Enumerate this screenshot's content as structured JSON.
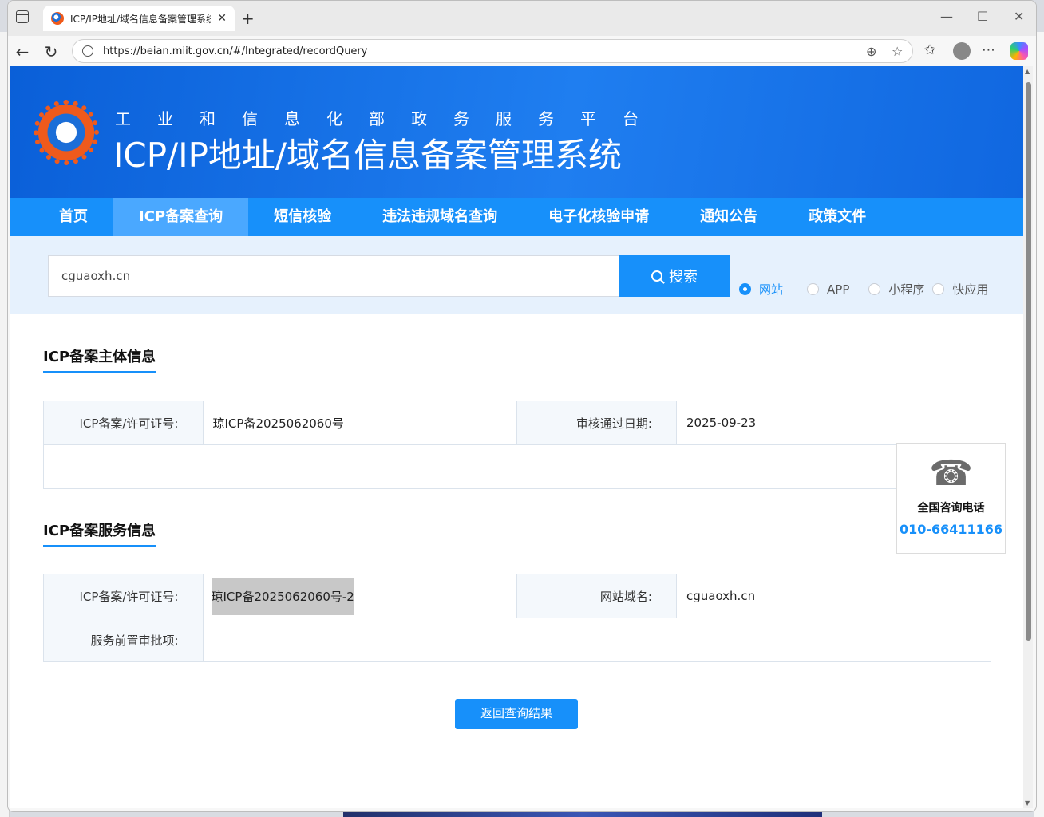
{
  "browser": {
    "tab_title": "ICP/IP地址/域名信息备案管理系统",
    "url": "https://beian.miit.gov.cn/#/Integrated/recordQuery"
  },
  "banner": {
    "subtitle": "工业和信息化部政务服务平台",
    "title": "ICP/IP地址/域名信息备案管理系统"
  },
  "nav": {
    "items": [
      "首页",
      "ICP备案查询",
      "短信核验",
      "违法违规域名查询",
      "电子化核验申请",
      "通知公告",
      "政策文件"
    ],
    "active_index": 1
  },
  "search": {
    "value": "cguaoxh.cn",
    "button_label": "搜索",
    "types": [
      "网站",
      "APP",
      "小程序",
      "快应用"
    ],
    "selected_type": "网站"
  },
  "subject_info": {
    "section_title": "ICP备案主体信息",
    "license_label": "ICP备案/许可证号:",
    "license_value": "琼ICP备2025062060号",
    "approval_date_label": "审核通过日期:",
    "approval_date_value": "2025-09-23"
  },
  "service_info": {
    "section_title": "ICP备案服务信息",
    "license_label": "ICP备案/许可证号:",
    "license_value": "琼ICP备2025062060号-2",
    "domain_label": "网站域名:",
    "domain_value": "cguaoxh.cn",
    "pre_approval_label": "服务前置审批项:",
    "pre_approval_value": ""
  },
  "hotline": {
    "label": "全国咨询电话",
    "number": "010-66411166"
  },
  "back_button_label": "返回查询结果",
  "colors": {
    "primary": "#1790fa",
    "banner": "#1f7ef0",
    "search_bg": "#e6f1fd"
  }
}
